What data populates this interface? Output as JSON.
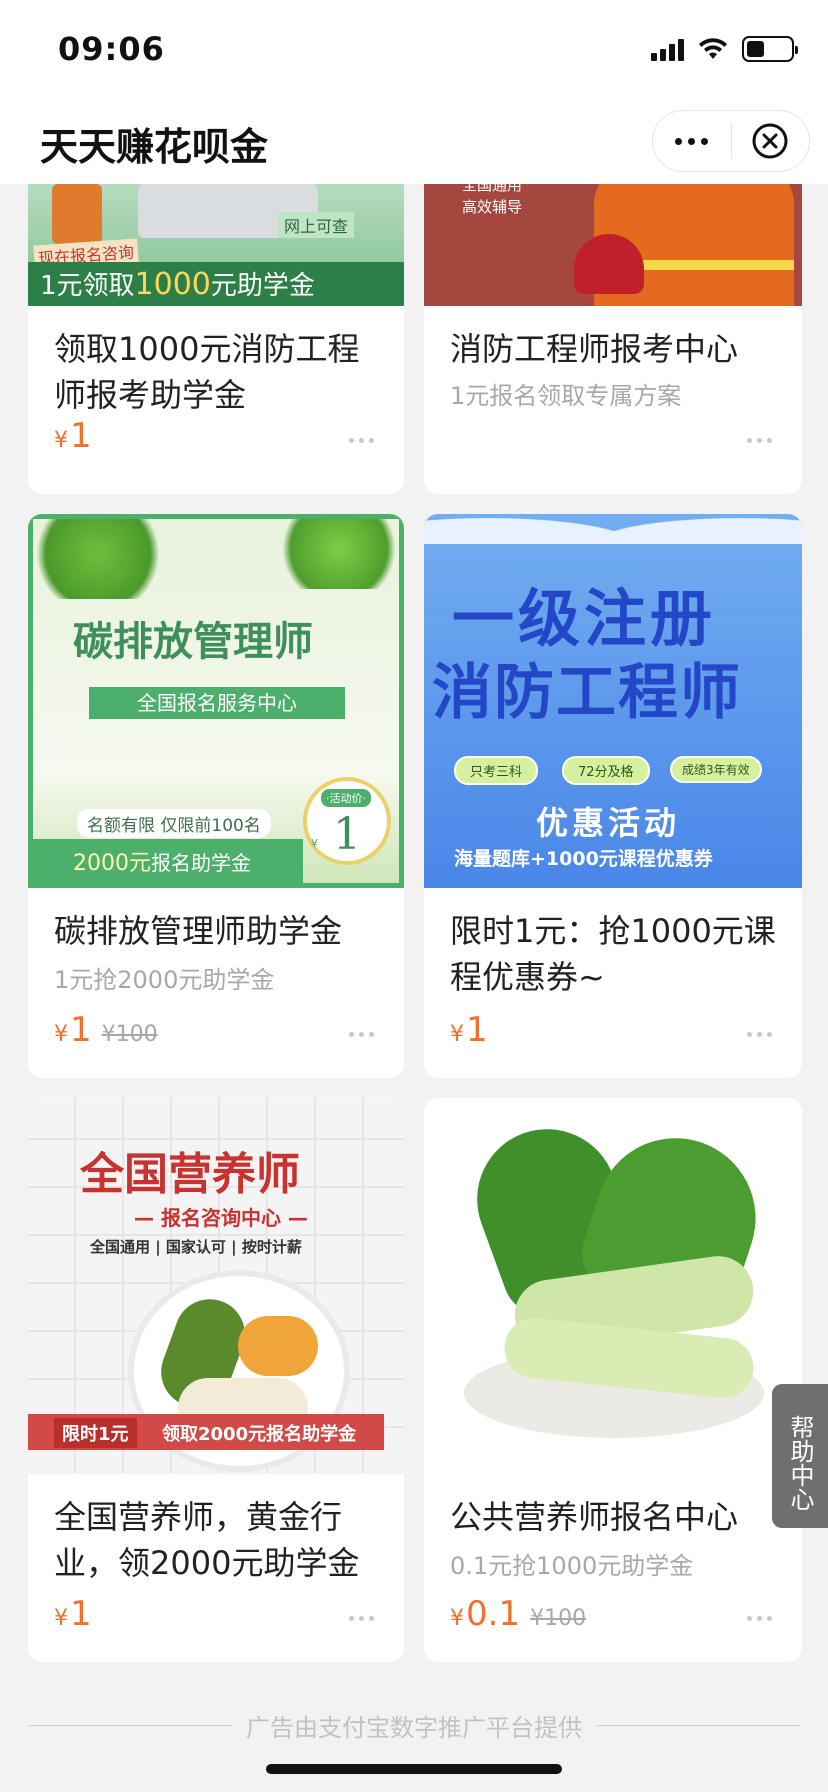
{
  "status_bar": {
    "time": "09:06"
  },
  "nav": {
    "title": "天天赚花呗金"
  },
  "cards": [
    {
      "image_texts": [
        "网上可查",
        "现在报名咨询",
        "1元领取",
        "1000",
        "元助学金"
      ],
      "title": "领取1000元消防工程师报考助学金",
      "price_symbol": "¥",
      "price": "1"
    },
    {
      "image_texts": [
        "全国通用",
        "高效辅导"
      ],
      "title": "消防工程师报考中心",
      "subtitle": "1元报名领取专属方案"
    },
    {
      "image_texts": [
        "碳排放管理师",
        "全国报名服务中心",
        "名额有限 仅限前100名",
        "2000元",
        "报名助学金",
        "·活动价·",
        "¥",
        "1"
      ],
      "title": "碳排放管理师助学金",
      "subtitle": "1元抢2000元助学金",
      "price_symbol": "¥",
      "price": "1",
      "original_price": "¥100"
    },
    {
      "image_texts": [
        "一级注册",
        "消防工程师",
        "只考三科",
        "72分及格",
        "成绩3年有效",
        "优惠活动",
        "海量题库+1000元课程优惠券"
      ],
      "title": "限时1元：抢1000元课程优惠券~",
      "price_symbol": "¥",
      "price": "1"
    },
    {
      "image_texts": [
        "全国营养师",
        "— 报名咨询中心 —",
        "全国通用 | 国家认可 | 按时计薪",
        "限时1元",
        "领取2000元报名助学金"
      ],
      "title": "全国营养师，黄金行业，领2000元助学金",
      "price_symbol": "¥",
      "price": "1"
    },
    {
      "title": "公共营养师报名中心",
      "subtitle": "0.1元抢1000元助学金",
      "price_symbol": "¥",
      "price": "0.1",
      "original_price": "¥100"
    }
  ],
  "help_tab": "帮助中心",
  "footer": "广告由支付宝数字推广平台提供",
  "colors": {
    "price": "#f0702c",
    "muted": "#a8a8a8",
    "background": "#f2f2f2"
  }
}
